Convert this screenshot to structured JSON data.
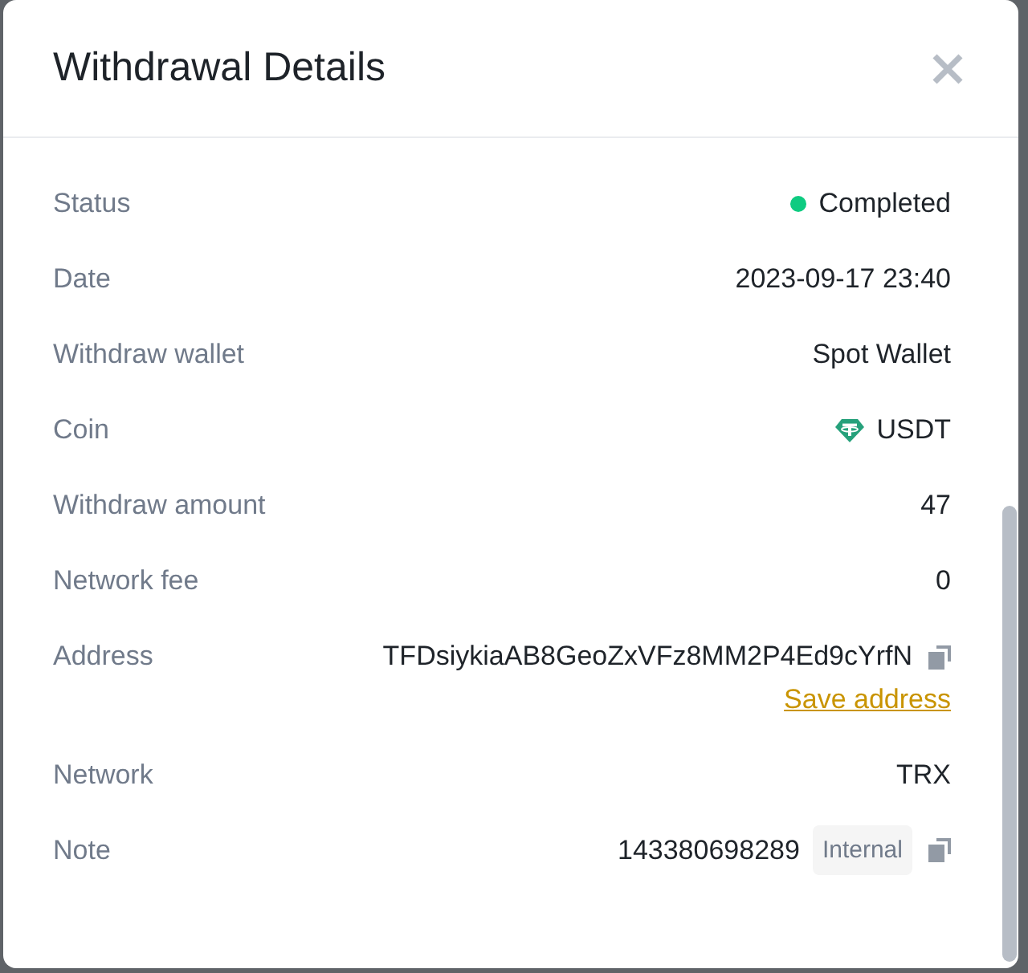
{
  "dialog": {
    "title": "Withdrawal Details"
  },
  "rows": [
    {
      "kind": "status",
      "label": "Status",
      "value": "Completed",
      "color": "#0ecb81"
    },
    {
      "kind": "text",
      "label": "Date",
      "value": "2023-09-17 23:40"
    },
    {
      "kind": "text",
      "label": "Withdraw wallet",
      "value": "Spot Wallet"
    },
    {
      "kind": "coin",
      "label": "Coin",
      "value": "USDT"
    },
    {
      "kind": "text",
      "label": "Withdraw amount",
      "value": "47"
    },
    {
      "kind": "text",
      "label": "Network fee",
      "value": "0"
    },
    {
      "kind": "address",
      "label": "Address",
      "value": "TFDsiykiaAB8GeoZxVFz8MM2P4Ed9cYrfN",
      "link": "Save address"
    },
    {
      "kind": "text",
      "label": "Network",
      "value": "TRX"
    },
    {
      "kind": "note",
      "label": "Note",
      "value": "143380698289",
      "tag": "Internal"
    }
  ]
}
